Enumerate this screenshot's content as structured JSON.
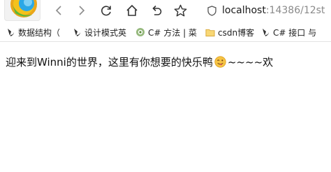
{
  "toolbar": {
    "address": {
      "host": "localhost",
      "rest": ":14386/12st"
    }
  },
  "bookmarks": [
    {
      "label": "数据结构（",
      "icon": "csdn-bookmark-icon"
    },
    {
      "label": "设计模式英",
      "icon": "csdn-bookmark-icon"
    },
    {
      "label": "C# 方法 | 菜",
      "icon": "runoob-bookmark-icon"
    },
    {
      "label": "csdn博客",
      "icon": "folder-icon"
    },
    {
      "label": "C# 接口 与",
      "icon": "csdn-bookmark-icon"
    }
  ],
  "content": {
    "text_before": "迎来到Winni的世界，这里有你想要的快乐鸭",
    "emoji": "winking-face-tongue-emoji",
    "text_after": "~~~~欢"
  }
}
